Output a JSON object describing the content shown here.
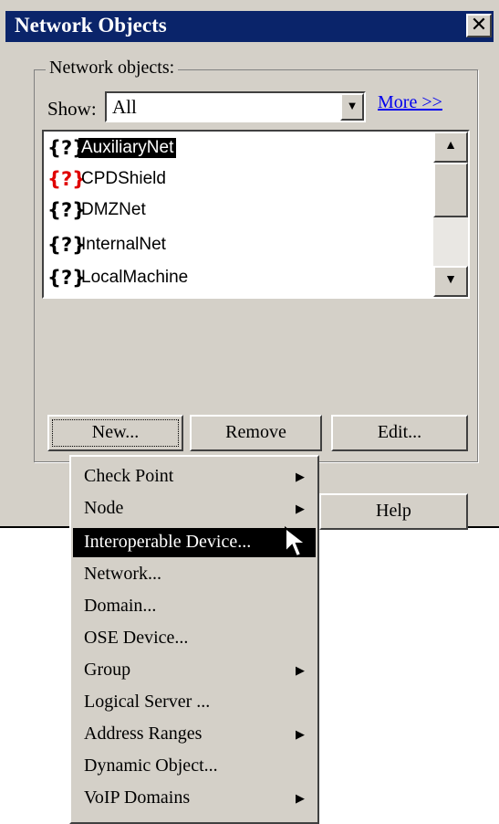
{
  "window": {
    "title": "Network Objects",
    "close_label": "✕"
  },
  "group_label": "Network objects:",
  "show": {
    "label": "Show:",
    "value": "All"
  },
  "more_link": "More >>",
  "list": {
    "items": [
      {
        "label": "AuxiliaryNet",
        "icon": "?",
        "selected": true,
        "icon_color": "#000000"
      },
      {
        "label": "CPDShield",
        "icon": "?",
        "selected": false,
        "icon_color": "#e00000"
      },
      {
        "label": "DMZNet",
        "icon": "?",
        "selected": false,
        "icon_color": "#000000"
      },
      {
        "label": "InternalNet",
        "icon": "?",
        "selected": false,
        "icon_color": "#000000"
      },
      {
        "label": "LocalMachine",
        "icon": "?",
        "selected": false,
        "icon_color": "#000000"
      }
    ]
  },
  "buttons": {
    "new": "New...",
    "remove": "Remove",
    "edit": "Edit...",
    "help": "Help"
  },
  "menu": {
    "items": [
      {
        "label": "Check Point",
        "submenu": true
      },
      {
        "label": "Node",
        "submenu": true
      },
      {
        "label": "Interoperable Device...",
        "submenu": false,
        "highlighted": true
      },
      {
        "label": "Network...",
        "submenu": false
      },
      {
        "label": "Domain...",
        "submenu": false
      },
      {
        "label": "OSE Device...",
        "submenu": false
      },
      {
        "label": "Group",
        "submenu": true
      },
      {
        "label": "Logical Server ...",
        "submenu": false
      },
      {
        "label": "Address Ranges",
        "submenu": true
      },
      {
        "label": "Dynamic Object...",
        "submenu": false
      },
      {
        "label": "VoIP Domains",
        "submenu": true
      }
    ]
  }
}
